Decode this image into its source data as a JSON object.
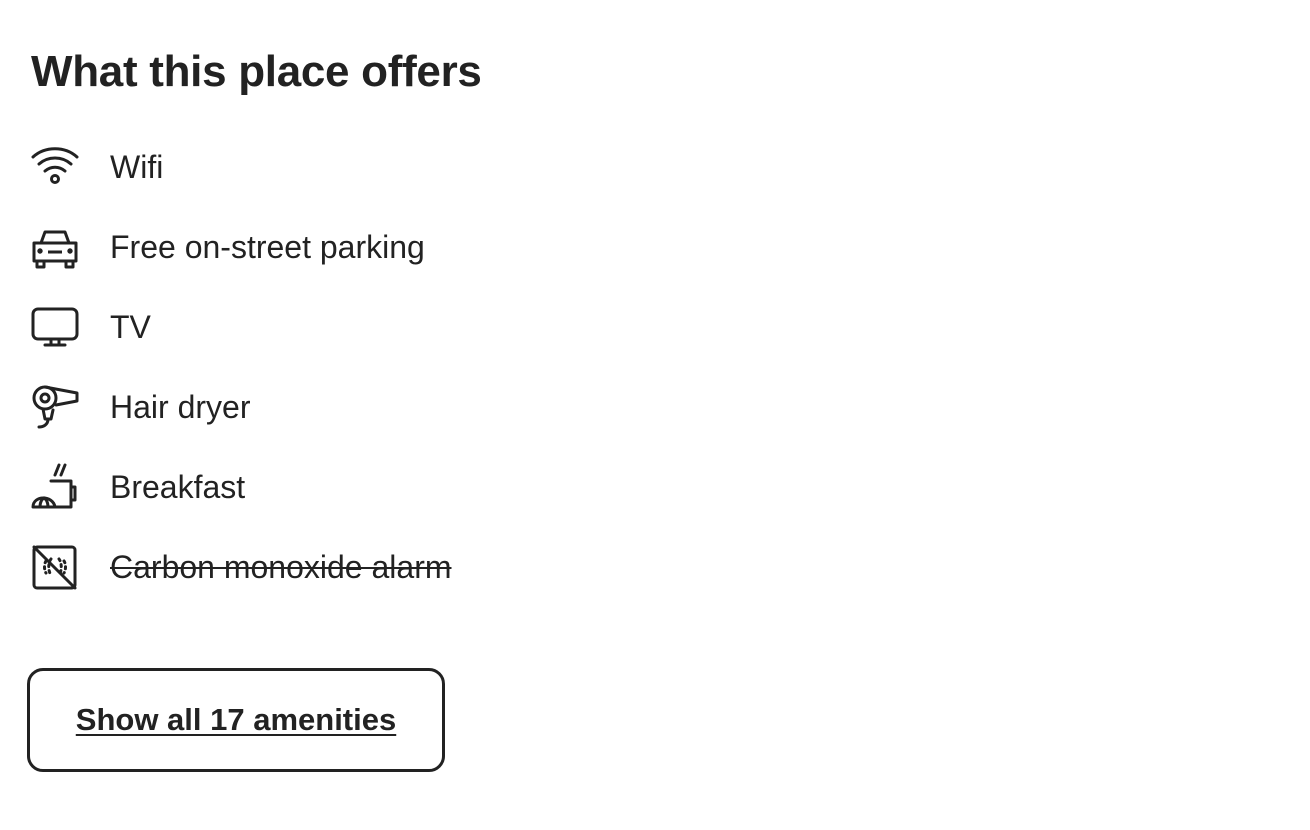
{
  "section": {
    "title": "What this place offers"
  },
  "amenities": [
    {
      "label": "Wifi",
      "icon": "wifi-icon",
      "available": true
    },
    {
      "label": "Free on-street parking",
      "icon": "car-icon",
      "available": true
    },
    {
      "label": "TV",
      "icon": "tv-icon",
      "available": true
    },
    {
      "label": "Hair dryer",
      "icon": "hair-dryer-icon",
      "available": true
    },
    {
      "label": "Breakfast",
      "icon": "breakfast-icon",
      "available": true
    },
    {
      "label": "Carbon monoxide alarm",
      "icon": "carbon-monoxide-alarm-off-icon",
      "available": false
    }
  ],
  "actions": {
    "show_all_label": "Show all 17 amenities"
  },
  "colors": {
    "text": "#222222",
    "background": "#ffffff",
    "border": "#222222"
  }
}
